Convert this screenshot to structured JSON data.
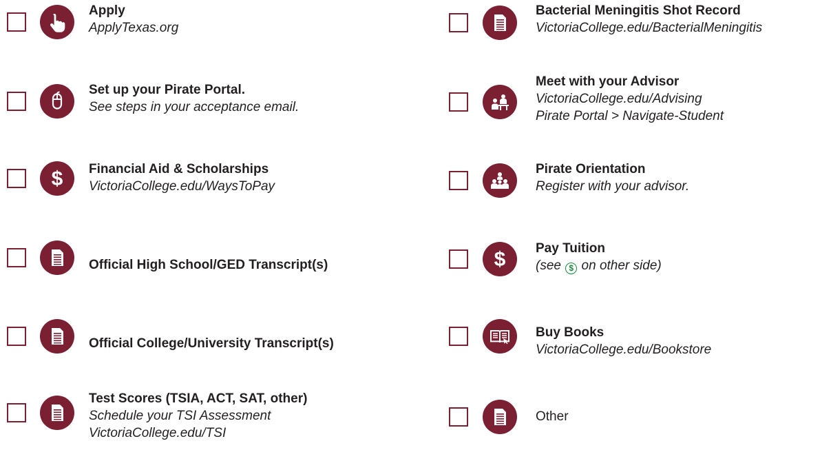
{
  "colors": {
    "accent": "#7b1f32",
    "text": "#231f20",
    "dollar_green": "#1a8a3b"
  },
  "left": [
    {
      "icon": "pointer-hand-icon",
      "title": "Apply",
      "lines": [
        "ApplyTexas.org"
      ]
    },
    {
      "icon": "mouse-icon",
      "title": "Set up your Pirate Portal.",
      "lines": [
        "See steps in your acceptance email."
      ]
    },
    {
      "icon": "dollar-icon",
      "title": "Financial Aid & Scholarships",
      "lines": [
        "VictoriaCollege.edu/WaysToPay"
      ]
    },
    {
      "icon": "document-icon",
      "title": "Official High School/GED Transcript(s)",
      "lines": []
    },
    {
      "icon": "document-icon",
      "title": "Official College/University Transcript(s)",
      "lines": []
    },
    {
      "icon": "document-icon",
      "title": "Test Scores (TSIA, ACT, SAT, other)",
      "lines": [
        "Schedule your TSI Assessment",
        "VictoriaCollege.edu/TSI"
      ]
    }
  ],
  "right": [
    {
      "icon": "document-icon",
      "title": "Bacterial Meningitis Shot Record",
      "lines": [
        "VictoriaCollege.edu/BacterialMeningitis"
      ]
    },
    {
      "icon": "advisor-icon",
      "title": "Meet with your Advisor",
      "lines": [
        "VictoriaCollege.edu/Advising",
        "Pirate Portal > Navigate-Student"
      ]
    },
    {
      "icon": "group-icon",
      "title": "Pirate Orientation",
      "lines": [
        "Register with your advisor."
      ]
    },
    {
      "icon": "dollar-icon",
      "title": "Pay Tuition",
      "note_pre": "(see ",
      "note_symbol": "$",
      "note_post": " on other side)"
    },
    {
      "icon": "book-icon",
      "title": "Buy Books",
      "lines": [
        "VictoriaCollege.edu/Bookstore"
      ]
    },
    {
      "icon": "document-icon",
      "plain": "Other"
    }
  ]
}
